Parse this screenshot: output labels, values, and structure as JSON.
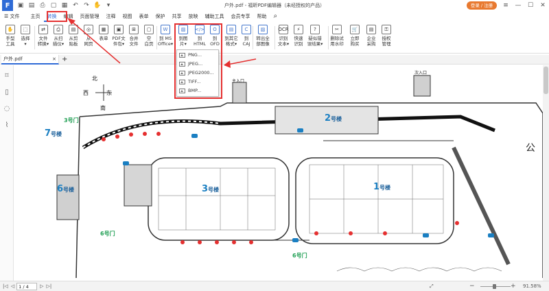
{
  "app": {
    "logo_text": "F",
    "doc_title": "户外.pdf - 福昕PDF编辑器（未经授权的产品）",
    "login_label": "登录 / 注册"
  },
  "window": {
    "minimize": "—",
    "maximize": "☐",
    "close": "✕",
    "settings": "≡"
  },
  "quick_access": {
    "save": "▣",
    "open": "▤",
    "print": "⎙",
    "doc": "▢",
    "pages": "▦",
    "undo": "↶",
    "redo": "↷",
    "hand": "✋",
    "more": "▾"
  },
  "menu": {
    "toggle_label": "☰ 文件",
    "items": [
      "主页",
      "转换",
      "编辑",
      "页面管理",
      "注释",
      "视图",
      "表单",
      "保护",
      "共享",
      "放映",
      "辅助工具",
      "会员专享",
      "帮助"
    ],
    "active": "转换",
    "search_icon": "⌕"
  },
  "toolbar": {
    "tools": [
      {
        "label": "手型\n工具",
        "icon": "✋"
      },
      {
        "label": "选择\n▾",
        "icon": "⬚"
      },
      {
        "label": "文件\n转换▾",
        "icon": "⇄"
      },
      {
        "label": "从扫\n描仪▾",
        "icon": "⎙"
      },
      {
        "label": "从剪\n贴板",
        "icon": "▤"
      },
      {
        "label": "从\n网页",
        "icon": "◎"
      },
      {
        "label": "表单",
        "icon": "▦"
      },
      {
        "label": "PDF文\n件包▾",
        "icon": "▣"
      },
      {
        "label": "合并\n文件",
        "icon": "⊞"
      },
      {
        "label": "空\n白页",
        "icon": "▢"
      },
      {
        "label": "到 MS\nOffice▾",
        "icon": "W"
      },
      {
        "label": "到图\n片▾",
        "icon": "▨"
      },
      {
        "label": "到\nHTML",
        "icon": "</>"
      },
      {
        "label": "到\nOFD",
        "icon": "O"
      },
      {
        "label": "到其它\n格式▾",
        "icon": "▤"
      },
      {
        "label": "到\nCAJ",
        "icon": "C"
      },
      {
        "label": "转出全\n部图像",
        "icon": "▨"
      },
      {
        "label": "识别\n文本▾",
        "icon": "OCR"
      },
      {
        "label": "快速\n识别",
        "icon": "⚡"
      },
      {
        "label": "疑似错\n误结果▾",
        "icon": "?"
      },
      {
        "label": "删除试\n用水印",
        "icon": "✂"
      },
      {
        "label": "立即\n购买",
        "icon": "🛒"
      },
      {
        "label": "企业\n采购",
        "icon": "▤"
      },
      {
        "label": "授权\n管理",
        "icon": "⚿"
      }
    ],
    "image_dropdown": [
      "PNG...",
      "JPEG...",
      "JPEG2000...",
      "TIFF...",
      "BMP..."
    ]
  },
  "tabs": {
    "doc_tab": "户外.pdf",
    "close_icon": "×",
    "add_icon": "+"
  },
  "sidebar": {
    "icons": [
      "bookmark",
      "pages",
      "comments",
      "attachments"
    ]
  },
  "map": {
    "north": "北",
    "south": "南",
    "west": "西",
    "east": "东",
    "buildings": [
      {
        "num": "1",
        "suffix": "号楼"
      },
      {
        "num": "2",
        "suffix": "号楼"
      },
      {
        "num": "3",
        "suffix": "号楼"
      },
      {
        "num": "6",
        "suffix": "号楼"
      },
      {
        "num": "7",
        "suffix": "号楼"
      }
    ],
    "gates": [
      "3号门",
      "6号门",
      "6号门"
    ],
    "entrances": [
      "主入口",
      "次入口"
    ],
    "edge_text": "公"
  },
  "status": {
    "page": "1 / 4",
    "zoom": "91.58%",
    "nav_first": "|◁",
    "nav_prev": "◁",
    "nav_next": "▷",
    "nav_last": "▷|",
    "zoom_out": "−",
    "zoom_in": "+",
    "fit": "⤢"
  },
  "colors": {
    "accent": "#2f6bd6",
    "highlight_box": "#e53030",
    "login": "#e8792f",
    "map_blue": "#1a7fc2",
    "gate_green": "#22a055"
  }
}
